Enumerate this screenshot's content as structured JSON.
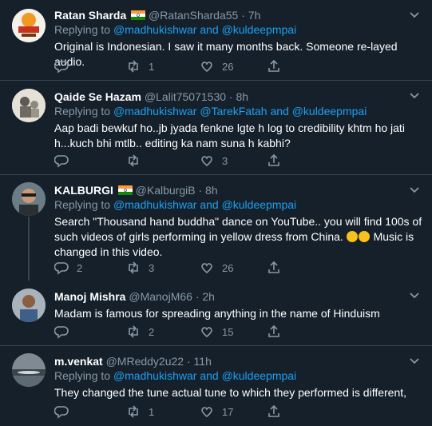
{
  "tweets": [
    {
      "name": "Ratan Sharda",
      "handle": "@RatanSharda55",
      "dot": "·",
      "time": "7h",
      "replying_label": "Replying to",
      "mentions": [
        "@madhukishwar",
        "and",
        "@kuldeepmpai"
      ],
      "text": "Original is Indonesian. I saw it many months back. Someone re-layed audio.",
      "replies": "",
      "retweets": "1",
      "likes": "26"
    },
    {
      "name": "Qaide Se Hazam",
      "handle": "@Lalit75071530",
      "dot": "·",
      "time": "8h",
      "replying_label": "Replying to",
      "mentions": [
        "@madhukishwar",
        "@TarekFatah",
        "and",
        "@kuldeepmpai"
      ],
      "text": "Aap badi bewkuf ho..jb jyada fenkne lgte h log to credibility khtm ho jati h...kuch bhi mtlb.. editing ka nam suna h kabhi?",
      "replies": "",
      "retweets": "",
      "likes": "3"
    },
    {
      "name": "KALBURGI",
      "handle": "@KalburgiB",
      "dot": "·",
      "time": "8h",
      "replying_label": "Replying to",
      "mentions": [
        "@madhukishwar",
        "and",
        "@kuldeepmpai"
      ],
      "text_a": "Search \"Thousand hand buddha\" dance on YouTube.. you will find 100s of such videos of girls performing in yellow dress from China.",
      "text_b": "Music is changed in this video.",
      "replies": "2",
      "retweets": "3",
      "likes": "26"
    },
    {
      "name": "Manoj Mishra",
      "handle": "@ManojM66",
      "dot": "·",
      "time": "2h",
      "text": "Madam is famous for spreading anything in the name of Hinduism",
      "replies": "",
      "retweets": "2",
      "likes": "15"
    },
    {
      "name": "m.venkat",
      "handle": "@MReddy2u22",
      "dot": "·",
      "time": "11h",
      "replying_label": "Replying to",
      "mentions": [
        "@madhukishwar",
        "and",
        "@kuldeepmpai"
      ],
      "text": "They changed the tune actual tune to which they performed is different,",
      "replies": "",
      "retweets": "1",
      "likes": "17"
    }
  ],
  "icons": {
    "reply": "reply-icon",
    "retweet": "retweet-icon",
    "like": "heart-icon",
    "share": "share-icon",
    "more": "chevron-down-icon"
  },
  "colors": {
    "background": "#15202b",
    "link": "#1da1f2",
    "muted": "#8899a6",
    "divider": "#38444d"
  }
}
